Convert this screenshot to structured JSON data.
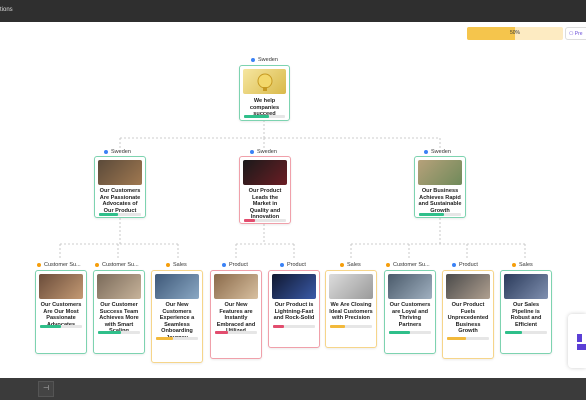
{
  "window": {
    "title_fragment": "tions"
  },
  "progress": {
    "label": "50%",
    "value": 0.5
  },
  "preview_button": {
    "label": "Pre"
  },
  "root": {
    "tag": "Sweden",
    "title": "We help companies succeed",
    "status": "green",
    "progress": 0.6
  },
  "level2": [
    {
      "tag": "Sweden",
      "title": "Our Customers Are Passionate Advocates of Our Product",
      "status": "green",
      "progress": 0.45
    },
    {
      "tag": "Sweden",
      "title": "Our Product Leads the Market in Quality and Innovation",
      "status": "red",
      "progress": 0.25
    },
    {
      "tag": "Sweden",
      "title": "Our Business Achieves Rapid and Sustainable Growth",
      "status": "green",
      "progress": 0.6
    }
  ],
  "level3": [
    {
      "tag": "Customer Su...",
      "dot": "orange",
      "title": "Our Customers Are Our Most Passionate Advocates",
      "status": "green",
      "progress": 0.5
    },
    {
      "tag": "Customer Su...",
      "dot": "orange",
      "title": "Our Customer Success Team Achieves More with Smart Scaling",
      "status": "green",
      "progress": 0.55
    },
    {
      "tag": "Sales",
      "dot": "orange",
      "title": "Our New Customers Experience a Seamless Onboarding Journey",
      "status": "yellow",
      "progress": 0.4
    },
    {
      "tag": "Product",
      "dot": "blue",
      "title": "Our New Features are Instantly Embraced and Utilized",
      "status": "red",
      "progress": 0.3
    },
    {
      "tag": "Product",
      "dot": "blue",
      "title": "Our Product is Lightning-Fast and Rock-Solid",
      "status": "red",
      "progress": 0.25
    },
    {
      "tag": "Sales",
      "dot": "orange",
      "title": "We Are Closing Ideal Customers with Precision",
      "status": "yellow",
      "progress": 0.35
    },
    {
      "tag": "Customer Su...",
      "dot": "orange",
      "title": "Our Customers are Loyal and Thriving Partners",
      "status": "green",
      "progress": 0.5
    },
    {
      "tag": "Product",
      "dot": "blue",
      "title": "Our Product Fuels Unprecedented Business Growth",
      "status": "yellow",
      "progress": 0.45
    },
    {
      "tag": "Sales",
      "dot": "orange",
      "title": "Our Sales Pipeline is Robust and Efficient",
      "status": "green",
      "progress": 0.4
    }
  ],
  "colors": {
    "green": "#2fbf8a",
    "red": "#e24d6e",
    "yellow": "#f2b93b",
    "accent": "#5b3fd6"
  }
}
